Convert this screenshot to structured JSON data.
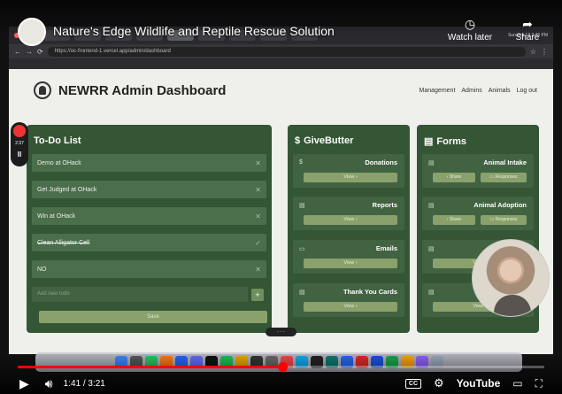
{
  "youtube": {
    "video_title": "Nature's Edge Wildlife and Reptile Rescue Solution",
    "watch_later": "Watch later",
    "share": "Share",
    "current_time": "1:41",
    "duration": "3:21",
    "time_display": "1:41 / 3:21",
    "progress_fraction": 0.502,
    "logo": "YouTube",
    "cc_label": "CC"
  },
  "browser": {
    "url": "https://oc-frontend-1.vercel.app/admin/dashboard",
    "clock": "Sun Oct 13 2:45 PM"
  },
  "recorder": {
    "time": "2:37"
  },
  "app": {
    "title": "NEWRR Admin Dashboard",
    "nav": [
      "Management",
      "Admins",
      "Animals",
      "Log out"
    ]
  },
  "todo": {
    "title": "To-Do List",
    "items": [
      {
        "text": "Demo at OHack",
        "done": false
      },
      {
        "text": "Get Judged at OHack",
        "done": false
      },
      {
        "text": "Win at OHack",
        "done": false
      },
      {
        "text": "Clean Alligator Cell",
        "done": true
      },
      {
        "text": "NO",
        "done": false
      }
    ],
    "new_placeholder": "Add new todo",
    "save_label": "Save"
  },
  "givebutter": {
    "title": "GiveButter",
    "tiles": [
      {
        "label": "Donations",
        "button": "View ›"
      },
      {
        "label": "Reports",
        "button": "View ›"
      },
      {
        "label": "Emails",
        "button": "View ›"
      },
      {
        "label": "Thank You Cards",
        "button": "View ›"
      }
    ]
  },
  "forms": {
    "title": "Forms",
    "tiles": [
      {
        "label": "Animal Intake",
        "share": "Share",
        "responses": "Responses"
      },
      {
        "label": "Animal Adoption",
        "share": "Share",
        "responses": "Responses"
      },
      {
        "label": "",
        "button": "View ›"
      },
      {
        "label": "",
        "button": "View ›"
      }
    ]
  },
  "colors": {
    "card_bg": "#345634",
    "row_bg": "#4b6e4b",
    "button_bg": "#8aa16c",
    "progress_red": "#ff0000"
  }
}
